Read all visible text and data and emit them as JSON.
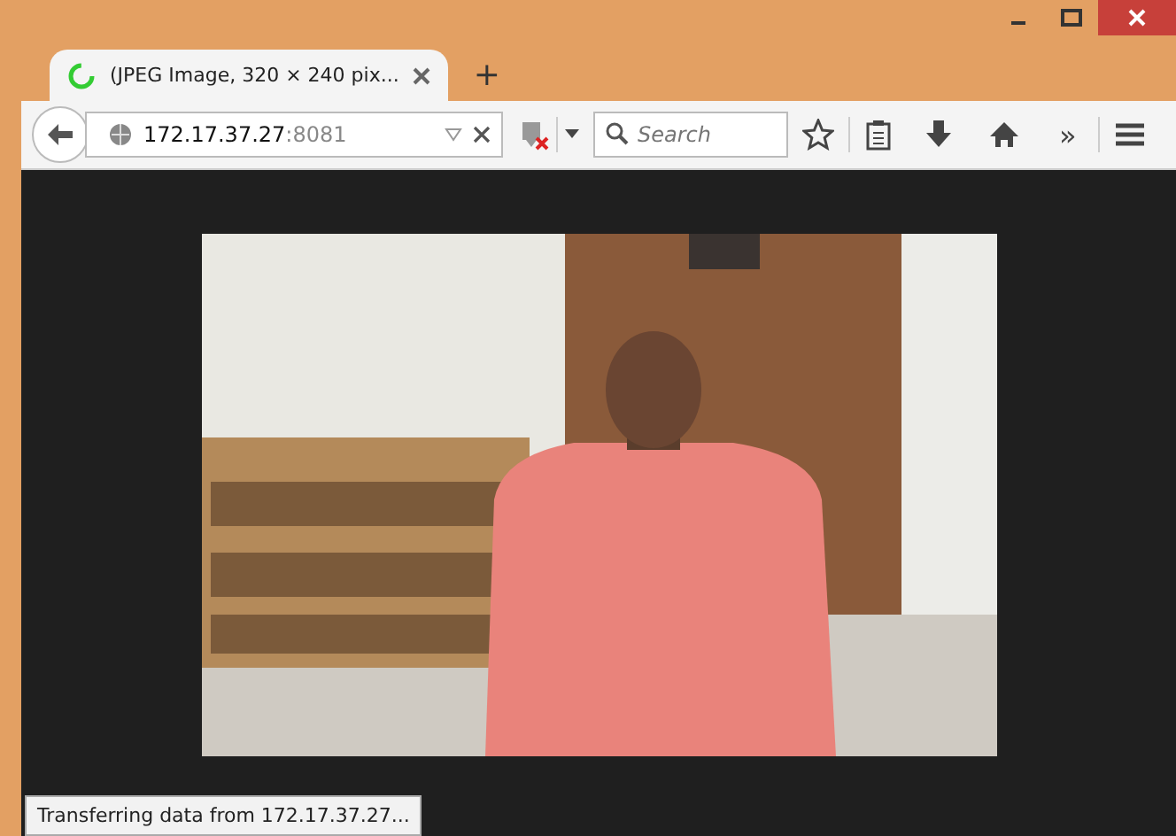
{
  "tab": {
    "title": "(JPEG Image, 320 × 240 pix..."
  },
  "new_tab": "+",
  "address": {
    "host": "172.17.37.27",
    "port": ":8081"
  },
  "search": {
    "placeholder": "Search"
  },
  "overflow": "»",
  "status": "Transferring data from 172.17.37.27..."
}
